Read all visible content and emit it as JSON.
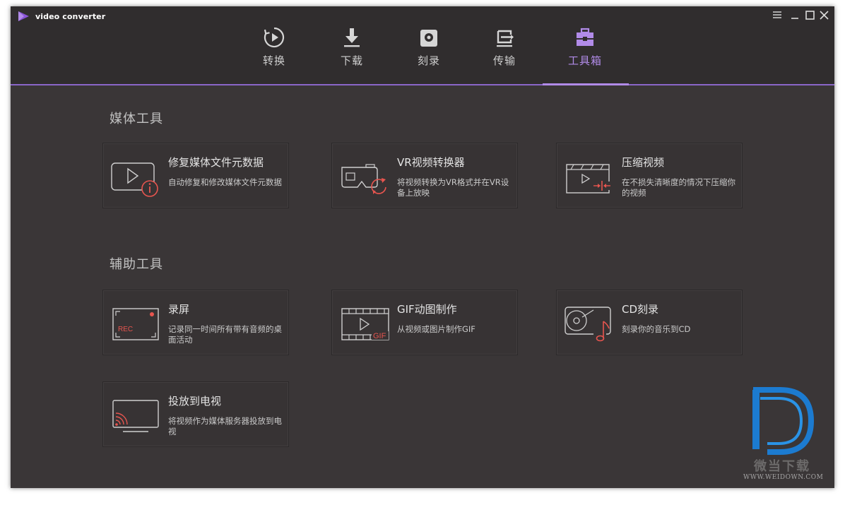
{
  "app": {
    "title": "video converter"
  },
  "nav": {
    "tabs": [
      {
        "label": "转换",
        "icon": "convert-icon"
      },
      {
        "label": "下载",
        "icon": "download-icon"
      },
      {
        "label": "刻录",
        "icon": "burn-icon"
      },
      {
        "label": "传输",
        "icon": "transfer-icon"
      },
      {
        "label": "工具箱",
        "icon": "toolbox-icon",
        "active": true
      }
    ]
  },
  "sections": {
    "media": {
      "title": "媒体工具",
      "cards": [
        {
          "title": "修复媒体文件元数据",
          "desc": "自动修复和修改媒体文件元数据",
          "icon": "metadata-icon"
        },
        {
          "title": "VR视频转换器",
          "desc": "将视频转换为VR格式并在VR设备上放映",
          "icon": "vr-icon"
        },
        {
          "title": "压缩视频",
          "desc": "在不损失清晰度的情况下压缩你的视频",
          "icon": "compress-icon"
        }
      ]
    },
    "aux": {
      "title": "辅助工具",
      "cards": [
        {
          "title": "录屏",
          "desc": "记录同一时间所有带有音频的桌面活动",
          "icon": "screen-record-icon",
          "badge": "REC"
        },
        {
          "title": "GIF动图制作",
          "desc": "从视频或图片制作GIF",
          "icon": "gif-icon",
          "badge": "GIF"
        },
        {
          "title": "CD刻录",
          "desc": "刻录你的音乐到CD",
          "icon": "cd-burn-icon"
        },
        {
          "title": "投放到电视",
          "desc": "将视频作为媒体服务器投放到电视",
          "icon": "cast-tv-icon"
        }
      ]
    }
  },
  "watermark": {
    "cn": "微当下载",
    "url": "WWW.WEIDOWN.COM"
  },
  "colors": {
    "accent": "#b18be8",
    "icon_red": "#e8554f",
    "background": "#3a3637",
    "topbar": "#302d2e"
  }
}
